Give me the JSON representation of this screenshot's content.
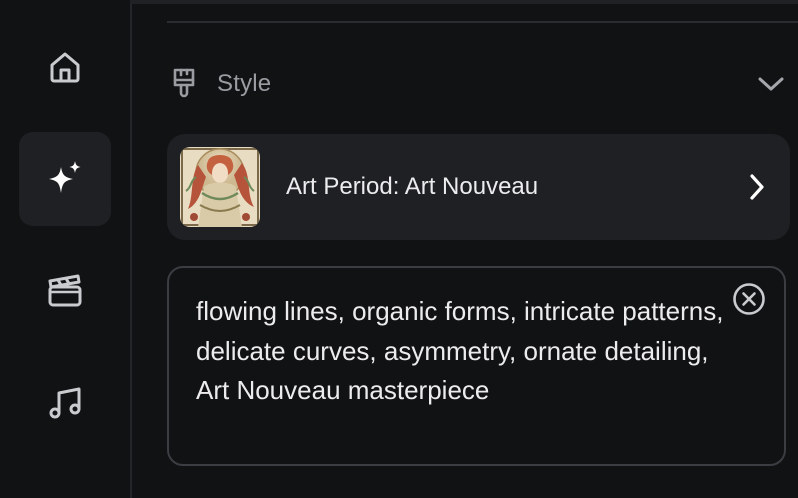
{
  "sidebar": {
    "items": [
      {
        "icon": "home-icon",
        "active": false
      },
      {
        "icon": "sparkles-icon",
        "active": true
      },
      {
        "icon": "clapperboard-icon",
        "active": false
      },
      {
        "icon": "music-note-icon",
        "active": false
      }
    ]
  },
  "style_section": {
    "title": "Style",
    "icon": "paintbrush-icon",
    "expanded": true
  },
  "art_period": {
    "label": "Art Period: Art Nouveau",
    "thumbnail": "art-nouveau-thumbnail"
  },
  "prompt": {
    "value": "flowing lines, organic forms, intricate patterns, delicate curves, asymmetry, ornate detailing, Art Nouveau masterpiece"
  },
  "colors": {
    "background": "#111214",
    "card": "#1e2023",
    "text": "#ececee",
    "muted": "#9a9ca1"
  }
}
